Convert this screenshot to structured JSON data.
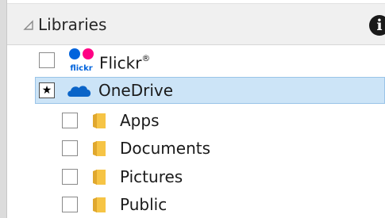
{
  "panel": {
    "header_title": "Libraries",
    "header_chevron_icon": "collapse-triangle-icon",
    "info_icon_glyph": "i",
    "info_icon": "info-icon"
  },
  "libraries": [
    {
      "label": "Flickr",
      "trademark": "®",
      "icon": "flickr-logo",
      "icon_text": "flickr",
      "checked": false,
      "selected": false
    },
    {
      "label": "OneDrive",
      "icon": "onedrive-cloud-icon",
      "check_glyph": "★",
      "checked": true,
      "selected": true
    }
  ],
  "onedrive_folders": [
    {
      "label": "Apps",
      "icon": "folder-icon",
      "checked": false
    },
    {
      "label": "Documents",
      "icon": "folder-icon",
      "checked": false
    },
    {
      "label": "Pictures",
      "icon": "folder-icon",
      "checked": false
    },
    {
      "label": "Public",
      "icon": "folder-icon",
      "checked": false
    }
  ],
  "colors": {
    "selection_bg": "#cce4f7",
    "selection_border": "#9ac4e8",
    "flickr_blue": "#0063dc",
    "flickr_pink": "#ff0084",
    "onedrive_blue": "#0a64c8",
    "folder_yellow": "#f6c445"
  }
}
